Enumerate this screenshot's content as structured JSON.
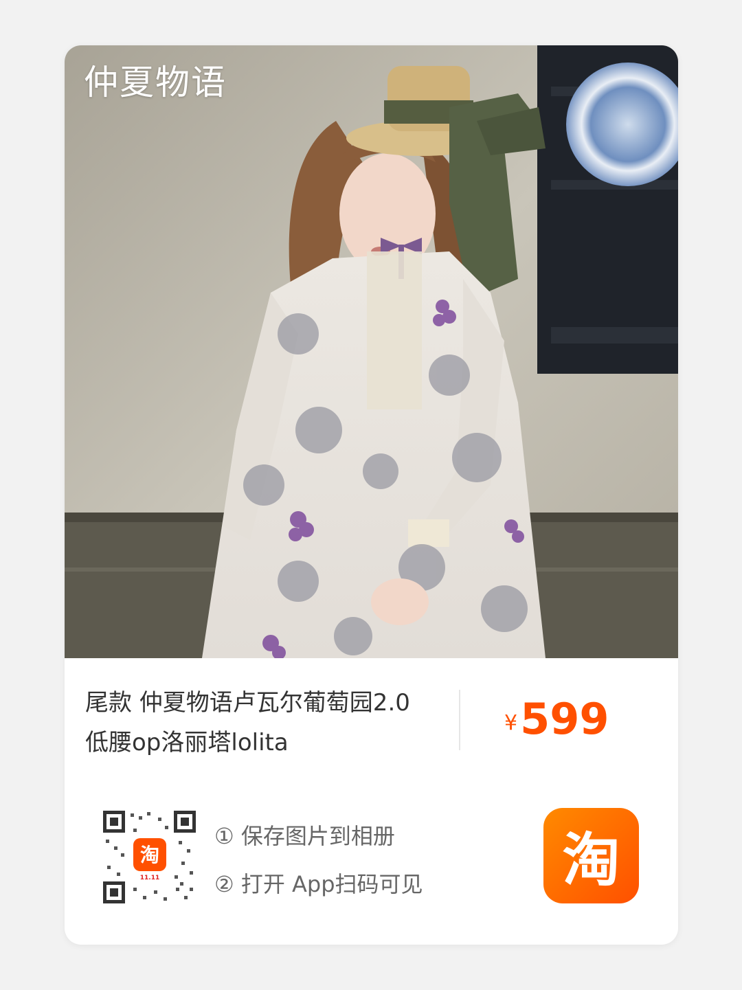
{
  "product": {
    "brand_watermark": "仲夏物语",
    "title": "尾款 仲夏物语卢瓦尔葡萄园2.0低腰op洛丽塔lolita",
    "price_currency": "¥",
    "price_value": "599",
    "price_color": "#ff5000"
  },
  "share": {
    "step1": "① 保存图片到相册",
    "step2": "② 打开 App扫码可见",
    "qr_badge_label": "11.11",
    "qr_badge_glyph": "淘",
    "app_button_glyph": "淘",
    "app_button_color": "#ff5000"
  },
  "icons": {
    "qr": "qr-code-icon",
    "app": "taobao-app-icon"
  }
}
